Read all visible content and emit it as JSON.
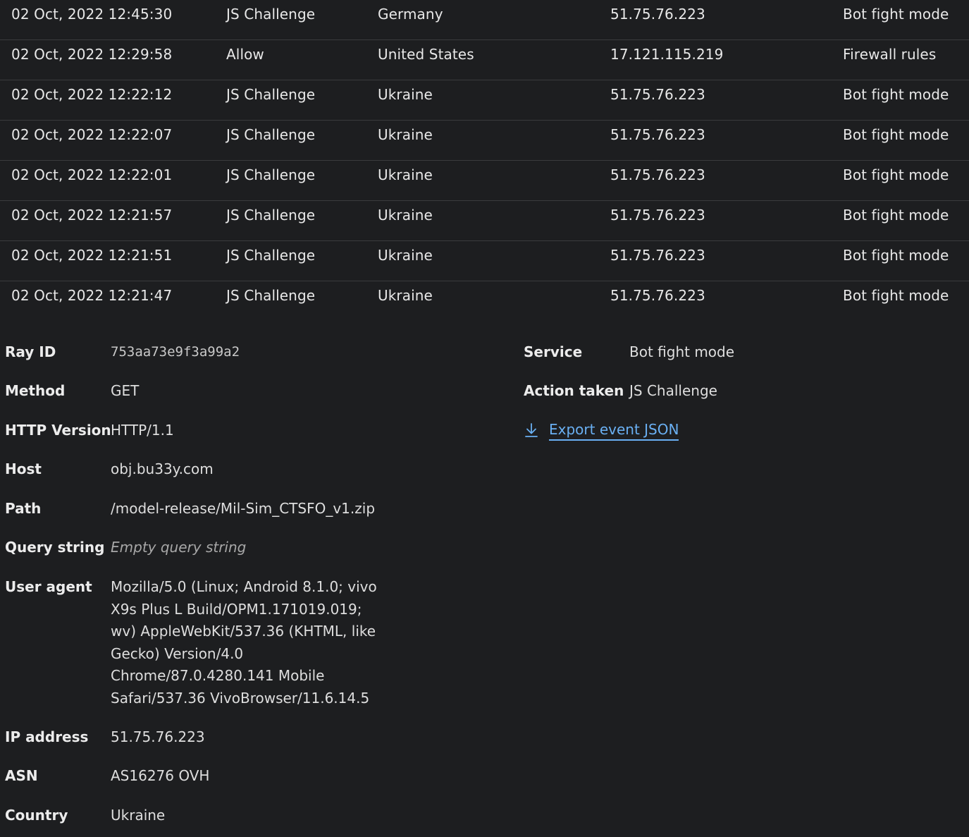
{
  "events": [
    {
      "date": "02 Oct, 2022 12:45:30",
      "action": "JS Challenge",
      "country": "Germany",
      "ip": "51.75.76.223",
      "service": "Bot fight mode"
    },
    {
      "date": "02 Oct, 2022 12:29:58",
      "action": "Allow",
      "country": "United States",
      "ip": "17.121.115.219",
      "service": "Firewall rules"
    },
    {
      "date": "02 Oct, 2022 12:22:12",
      "action": "JS Challenge",
      "country": "Ukraine",
      "ip": "51.75.76.223",
      "service": "Bot fight mode"
    },
    {
      "date": "02 Oct, 2022 12:22:07",
      "action": "JS Challenge",
      "country": "Ukraine",
      "ip": "51.75.76.223",
      "service": "Bot fight mode"
    },
    {
      "date": "02 Oct, 2022 12:22:01",
      "action": "JS Challenge",
      "country": "Ukraine",
      "ip": "51.75.76.223",
      "service": "Bot fight mode"
    },
    {
      "date": "02 Oct, 2022 12:21:57",
      "action": "JS Challenge",
      "country": "Ukraine",
      "ip": "51.75.76.223",
      "service": "Bot fight mode"
    },
    {
      "date": "02 Oct, 2022 12:21:51",
      "action": "JS Challenge",
      "country": "Ukraine",
      "ip": "51.75.76.223",
      "service": "Bot fight mode"
    },
    {
      "date": "02 Oct, 2022 12:21:47",
      "action": "JS Challenge",
      "country": "Ukraine",
      "ip": "51.75.76.223",
      "service": "Bot fight mode"
    }
  ],
  "details": {
    "ray_id": {
      "label": "Ray ID",
      "value": "753aa73e9f3a99a2"
    },
    "method": {
      "label": "Method",
      "value": "GET"
    },
    "http_version": {
      "label": "HTTP Version",
      "value": "HTTP/1.1"
    },
    "host": {
      "label": "Host",
      "value": "obj.bu33y.com"
    },
    "path": {
      "label": "Path",
      "value": "/model-release/Mil-Sim_CTSFO_v1.zip"
    },
    "query_string": {
      "label": "Query string",
      "value": "Empty query string"
    },
    "user_agent": {
      "label": "User agent",
      "value": "Mozilla/5.0 (Linux; Android 8.1.0; vivo X9s Plus L Build/OPM1.171019.019; wv) AppleWebKit/537.36 (KHTML, like Gecko) Version/4.0 Chrome/87.0.4280.141 Mobile Safari/537.36 VivoBrowser/11.6.14.5"
    },
    "ip_address": {
      "label": "IP address",
      "value": "51.75.76.223"
    },
    "asn": {
      "label": "ASN",
      "value": "AS16276 OVH"
    },
    "country": {
      "label": "Country",
      "value": "Ukraine"
    },
    "service": {
      "label": "Service",
      "value": "Bot fight mode"
    },
    "action_taken": {
      "label": "Action taken",
      "value": "JS Challenge"
    }
  },
  "export": {
    "label": "Export event JSON",
    "icon": "download-icon",
    "color": "#6ab0f3"
  }
}
